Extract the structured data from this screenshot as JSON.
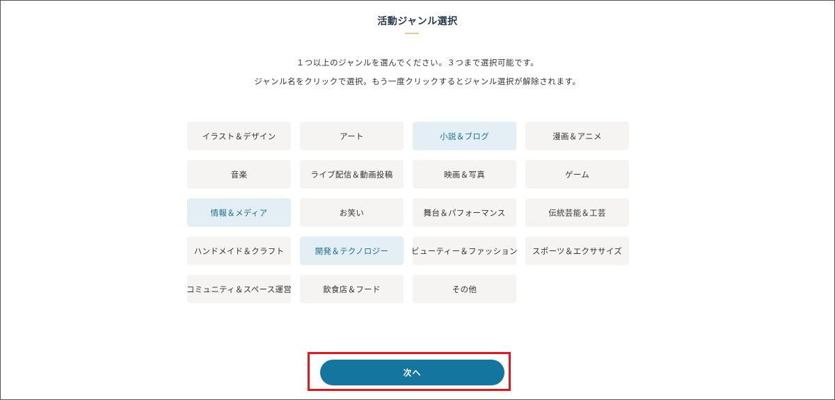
{
  "page": {
    "title": "活動ジャンル選択",
    "instruction_line1": "１つ以上のジャンルを選んでください。３つまで選択可能です。",
    "instruction_line2": "ジャンル名をクリックで選択。もう一度クリックするとジャンル選択が解除されます。"
  },
  "genres": [
    {
      "label": "イラスト＆デザイン",
      "selected": false
    },
    {
      "label": "アート",
      "selected": false
    },
    {
      "label": "小説＆ブログ",
      "selected": true
    },
    {
      "label": "漫画＆アニメ",
      "selected": false
    },
    {
      "label": "音楽",
      "selected": false
    },
    {
      "label": "ライブ配信＆動画投稿",
      "selected": false
    },
    {
      "label": "映画＆写真",
      "selected": false
    },
    {
      "label": "ゲーム",
      "selected": false
    },
    {
      "label": "情報＆メディア",
      "selected": true
    },
    {
      "label": "お笑い",
      "selected": false
    },
    {
      "label": "舞台＆パフォーマンス",
      "selected": false
    },
    {
      "label": "伝統芸能＆工芸",
      "selected": false
    },
    {
      "label": "ハンドメイド＆クラフト",
      "selected": false
    },
    {
      "label": "開発＆テクノロジー",
      "selected": true
    },
    {
      "label": "ビューティー＆ファッション",
      "selected": false
    },
    {
      "label": "スポーツ＆エクササイズ",
      "selected": false
    },
    {
      "label": "コミュニティ＆スペース運営",
      "selected": false
    },
    {
      "label": "飲食店＆フード",
      "selected": false
    },
    {
      "label": "その他",
      "selected": false
    }
  ],
  "next_button": {
    "label": "次へ"
  },
  "colors": {
    "accent": "#14769f",
    "selected_bg": "#e3eff5",
    "selected_text": "#1a6d8f",
    "unselected_bg": "#f5f4f2",
    "title_underline": "#f0c48a",
    "highlight_box": "#e8141b"
  }
}
